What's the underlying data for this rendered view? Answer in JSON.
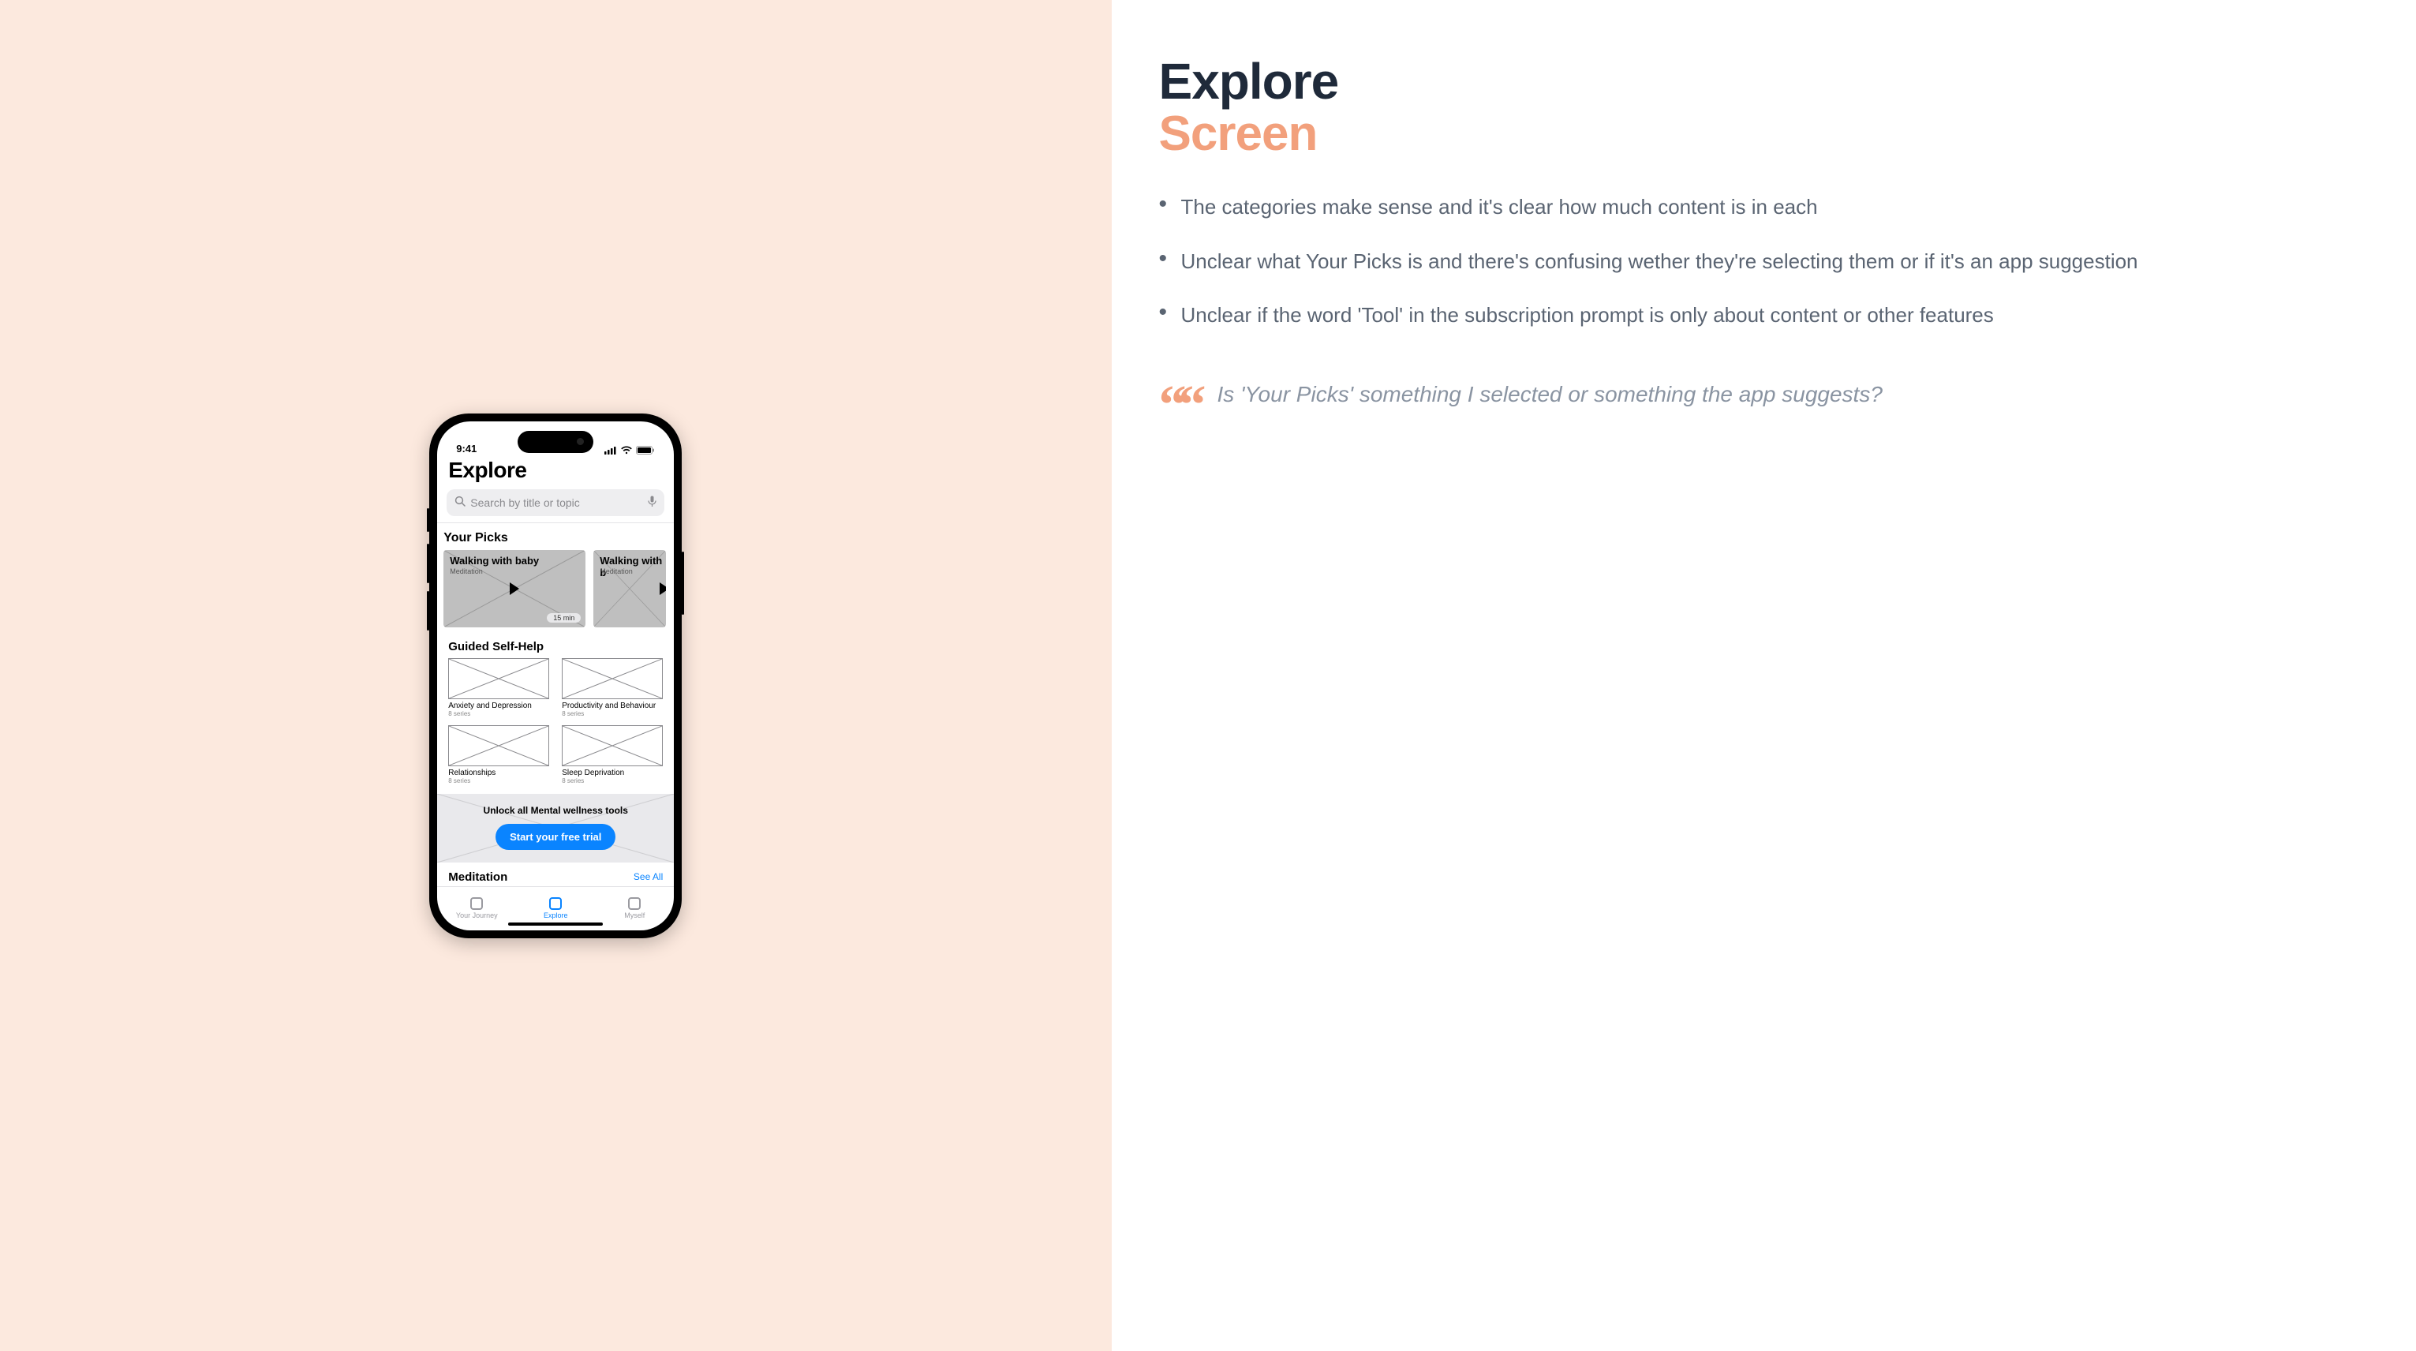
{
  "slide": {
    "heading_main": "Explore",
    "heading_sub": "Screen",
    "bullets": [
      "The categories make sense and it's clear how much content is in each",
      "Unclear what Your Picks is and there's confusing wether they're selecting them or if it's an app suggestion",
      "Unclear if the word 'Tool' in the subscription prompt is only about content or other features"
    ],
    "quote": "Is 'Your Picks' something I selected or something the app suggests?"
  },
  "phone": {
    "status_time": "9:41",
    "page_title": "Explore",
    "search_placeholder": "Search by title or topic",
    "sections": {
      "picks_title": "Your Picks",
      "picks": [
        {
          "title": "Walking with baby",
          "subtitle": "Meditation",
          "duration": "15 min"
        },
        {
          "title": "Walking with b",
          "subtitle": "Meditation",
          "duration": ""
        }
      ],
      "gsh_title": "Guided Self-Help",
      "gsh": [
        {
          "label": "Anxiety and Depression",
          "count": "8 series"
        },
        {
          "label": "Productivity and Behaviour",
          "count": "8 series"
        },
        {
          "label": "Relationships",
          "count": "8 series"
        },
        {
          "label": "Sleep Deprivation",
          "count": "8 series"
        }
      ],
      "unlock_text": "Unlock all Mental wellness tools",
      "unlock_cta": "Start your free trial",
      "meditation_title": "Meditation",
      "see_all": "See All"
    },
    "tabs": [
      {
        "label": "Your Journey",
        "active": false
      },
      {
        "label": "Explore",
        "active": true
      },
      {
        "label": "Myself",
        "active": false
      }
    ]
  }
}
